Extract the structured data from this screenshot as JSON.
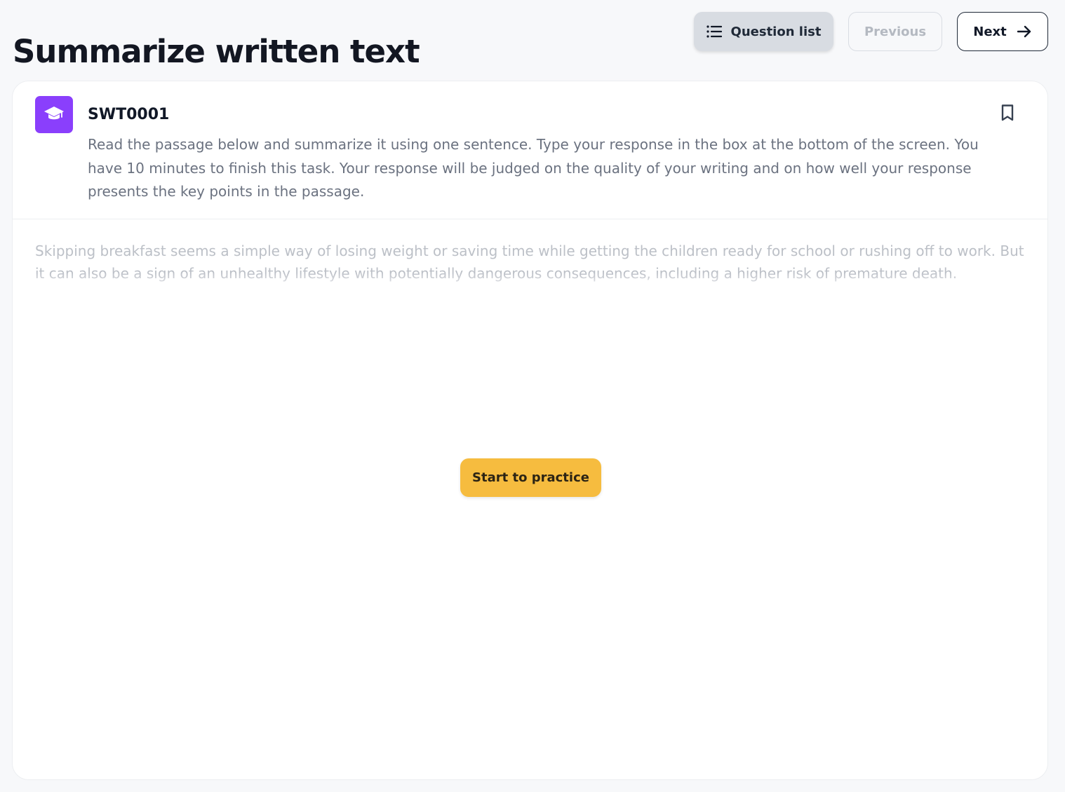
{
  "header": {
    "title": "Summarize written text",
    "actions": {
      "question_list_label": "Question list",
      "previous_label": "Previous",
      "next_label": "Next"
    }
  },
  "card": {
    "question_id": "SWT0001",
    "instruction": "Read the passage below and summarize it using one sentence. Type your response in the box at the bottom of the screen. You have 10 minutes to finish this task. Your response will be judged on the quality of your writing and on how well your response presents the key points in the passage.",
    "passage_preview": "Skipping breakfast seems a simple way of losing weight or saving time while getting the children ready for school or rushing off to work. But it can also be a sign of an unhealthy lifestyle with potentially dangerous consequences, including a higher risk of premature death.",
    "start_button_label": "Start to practice"
  },
  "icons": {
    "question_list": "list-icon",
    "next": "arrow-right-icon",
    "task": "graduation-cap-icon",
    "bookmark": "bookmark-icon"
  },
  "colors": {
    "background": "#f7f8fa",
    "card": "#ffffff",
    "task_badge": "#8a3ffc",
    "start_button": "#f6bc3f",
    "disabled_text": "#b4b9c1"
  }
}
